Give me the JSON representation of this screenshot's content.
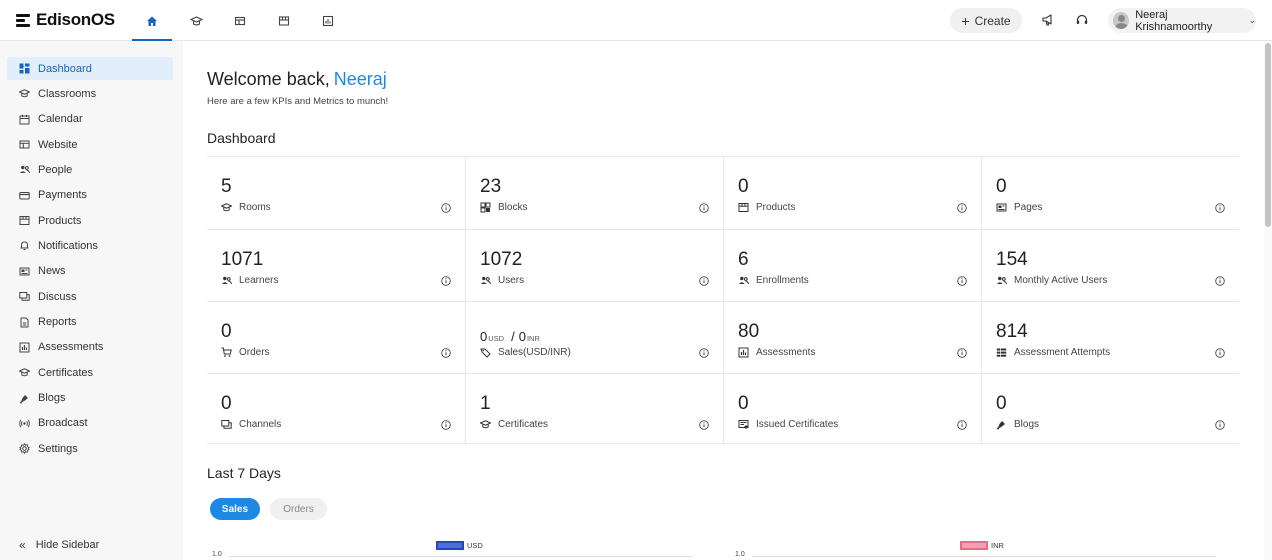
{
  "app": {
    "name": "EdisonOS"
  },
  "topnav": {
    "items": [
      {
        "icon": "home-icon",
        "active": true
      },
      {
        "icon": "classroom-icon",
        "active": false
      },
      {
        "icon": "website-icon",
        "active": false
      },
      {
        "icon": "store-icon",
        "active": false
      },
      {
        "icon": "reports-icon",
        "active": false
      }
    ],
    "create_label": "Create",
    "user_name": "Neeraj Krishnamoorthy"
  },
  "sidebar": {
    "items": [
      {
        "label": "Dashboard",
        "icon": "dashboard-icon",
        "active": true
      },
      {
        "label": "Classrooms",
        "icon": "classroom-icon"
      },
      {
        "label": "Calendar",
        "icon": "calendar-icon"
      },
      {
        "label": "Website",
        "icon": "website-icon"
      },
      {
        "label": "People",
        "icon": "people-icon"
      },
      {
        "label": "Payments",
        "icon": "payments-icon"
      },
      {
        "label": "Products",
        "icon": "products-icon"
      },
      {
        "label": "Notifications",
        "icon": "bell-icon"
      },
      {
        "label": "News",
        "icon": "news-icon"
      },
      {
        "label": "Discuss",
        "icon": "discuss-icon"
      },
      {
        "label": "Reports",
        "icon": "reports-icon"
      },
      {
        "label": "Assessments",
        "icon": "assessments-icon"
      },
      {
        "label": "Certificates",
        "icon": "certificate-icon"
      },
      {
        "label": "Blogs",
        "icon": "blogs-icon"
      },
      {
        "label": "Broadcast",
        "icon": "broadcast-icon"
      },
      {
        "label": "Settings",
        "icon": "settings-icon"
      }
    ],
    "hide_label": "Hide Sidebar"
  },
  "main": {
    "welcome": "Welcome back,",
    "user_first_name": "Neeraj",
    "subtitle": "Here are a few KPIs and Metrics to munch!",
    "dashboard_title": "Dashboard",
    "last7_title": "Last 7 Days",
    "tabs": {
      "sales": "Sales",
      "orders": "Orders"
    }
  },
  "kpis": [
    {
      "value": "5",
      "label": "Rooms",
      "icon": "classroom-icon"
    },
    {
      "value": "23",
      "label": "Blocks",
      "icon": "blocks-icon"
    },
    {
      "value": "0",
      "label": "Products",
      "icon": "products-icon"
    },
    {
      "value": "0",
      "label": "Pages",
      "icon": "pages-icon"
    },
    {
      "value": "1071",
      "label": "Learners",
      "icon": "people-icon"
    },
    {
      "value": "1072",
      "label": "Users",
      "icon": "people-icon"
    },
    {
      "value": "6",
      "label": "Enrollments",
      "icon": "people-icon"
    },
    {
      "value": "154",
      "label": "Monthly Active Users",
      "icon": "people-icon"
    },
    {
      "value": "0",
      "label": "Orders",
      "icon": "cart-icon"
    },
    {
      "value_usd": "0",
      "unit_usd": "USD",
      "value_inr": "0",
      "unit_inr": "INR",
      "label": "Sales(USD/INR)",
      "icon": "sales-icon"
    },
    {
      "value": "80",
      "label": "Assessments",
      "icon": "assessments-icon"
    },
    {
      "value": "814",
      "label": "Assessment Attempts",
      "icon": "list-icon"
    },
    {
      "value": "0",
      "label": "Channels",
      "icon": "discuss-icon"
    },
    {
      "value": "1",
      "label": "Certificates",
      "icon": "certificate-icon"
    },
    {
      "value": "0",
      "label": "Issued Certificates",
      "icon": "issued-certificate-icon"
    },
    {
      "value": "0",
      "label": "Blogs",
      "icon": "blogs-icon"
    }
  ],
  "charts": {
    "usd": {
      "legend": "USD",
      "color": "#4a6fdc",
      "y_top": "1.0"
    },
    "inr": {
      "legend": "INR",
      "color": "#f4a0b0",
      "y_top": "1.0"
    }
  },
  "colors": {
    "accent": "#1e88e5",
    "active_nav": "#1565c0"
  }
}
